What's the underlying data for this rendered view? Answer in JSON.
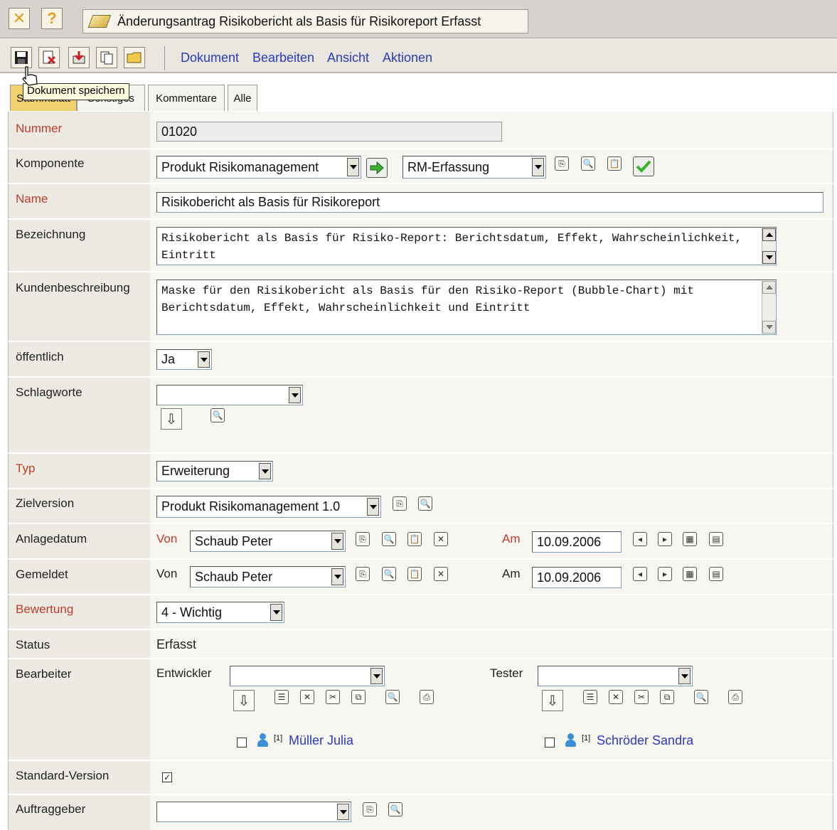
{
  "window": {
    "title": "Änderungsantrag Risikobericht als Basis für Risikoreport Erfasst"
  },
  "toolbar": {
    "menu": [
      "Dokument",
      "Bearbeiten",
      "Ansicht",
      "Aktionen"
    ],
    "tooltip": "Dokument speichern"
  },
  "tabs": [
    "Stammblatt",
    "Sonstiges",
    "Kommentare",
    "Alle"
  ],
  "form": {
    "nummer": {
      "label": "Nummer",
      "value": "01020"
    },
    "komponente": {
      "label": "Komponente",
      "value1": "Produkt Risikomanagement",
      "value2": "RM-Erfassung"
    },
    "name": {
      "label": "Name",
      "value": "Risikobericht als Basis für Risikoreport"
    },
    "bezeichnung": {
      "label": "Bezeichnung",
      "value": "Risikobericht als Basis für Risiko-Report: Berichtsdatum, Effekt, Wahrscheinlichkeit, Eintritt"
    },
    "kundenbeschreibung": {
      "label": "Kundenbeschreibung",
      "value": "Maske für den Risikobericht als Basis für den Risiko-Report (Bubble-Chart) mit Berichtsdatum, Effekt, Wahrscheinlichkeit und Eintritt"
    },
    "oeffentlich": {
      "label": "öffentlich",
      "value": "Ja"
    },
    "schlagworte": {
      "label": "Schlagworte",
      "value": ""
    },
    "typ": {
      "label": "Typ",
      "value": "Erweiterung"
    },
    "zielversion": {
      "label": "Zielversion",
      "value": "Produkt Risikomanagement 1.0"
    },
    "anlagedatum": {
      "label": "Anlagedatum",
      "von_label": "Von",
      "von": "Schaub Peter",
      "am_label": "Am",
      "am": "10.09.2006"
    },
    "gemeldet": {
      "label": "Gemeldet",
      "von_label": "Von",
      "von": "Schaub Peter",
      "am_label": "Am",
      "am": "10.09.2006"
    },
    "bewertung": {
      "label": "Bewertung",
      "value": "4 - Wichtig"
    },
    "status": {
      "label": "Status",
      "value": "Erfasst"
    },
    "bearbeiter": {
      "label": "Bearbeiter",
      "entwickler_label": "Entwickler",
      "tester_label": "Tester",
      "entwickler_person": {
        "index": "[1]",
        "name": "Müller Julia"
      },
      "tester_person": {
        "index": "[1]",
        "name": "Schröder Sandra"
      }
    },
    "standard_version": {
      "label": "Standard-Version",
      "checked": true
    },
    "auftraggeber": {
      "label": "Auftraggeber",
      "value": ""
    }
  }
}
